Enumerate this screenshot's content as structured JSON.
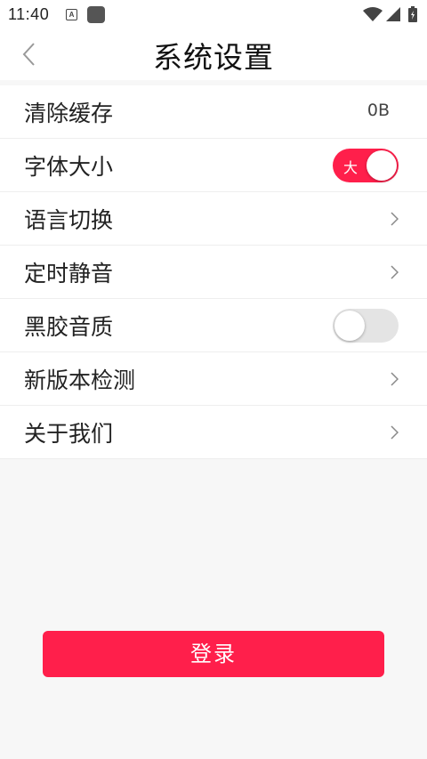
{
  "status_bar": {
    "time": "11:40",
    "note_icon_letter": "A"
  },
  "header": {
    "title": "系统设置"
  },
  "settings": [
    {
      "label": "清除缓存",
      "value": "0B"
    },
    {
      "label": "字体大小",
      "toggle_text": "大",
      "toggle_state": "on"
    },
    {
      "label": "语言切换"
    },
    {
      "label": "定时静音"
    },
    {
      "label": "黑胶音质",
      "toggle_state": "off"
    },
    {
      "label": "新版本检测"
    },
    {
      "label": "关于我们"
    }
  ],
  "login_button": {
    "label": "登录"
  },
  "colors": {
    "accent": "#ff1f4b",
    "background": "#f7f7f7"
  }
}
